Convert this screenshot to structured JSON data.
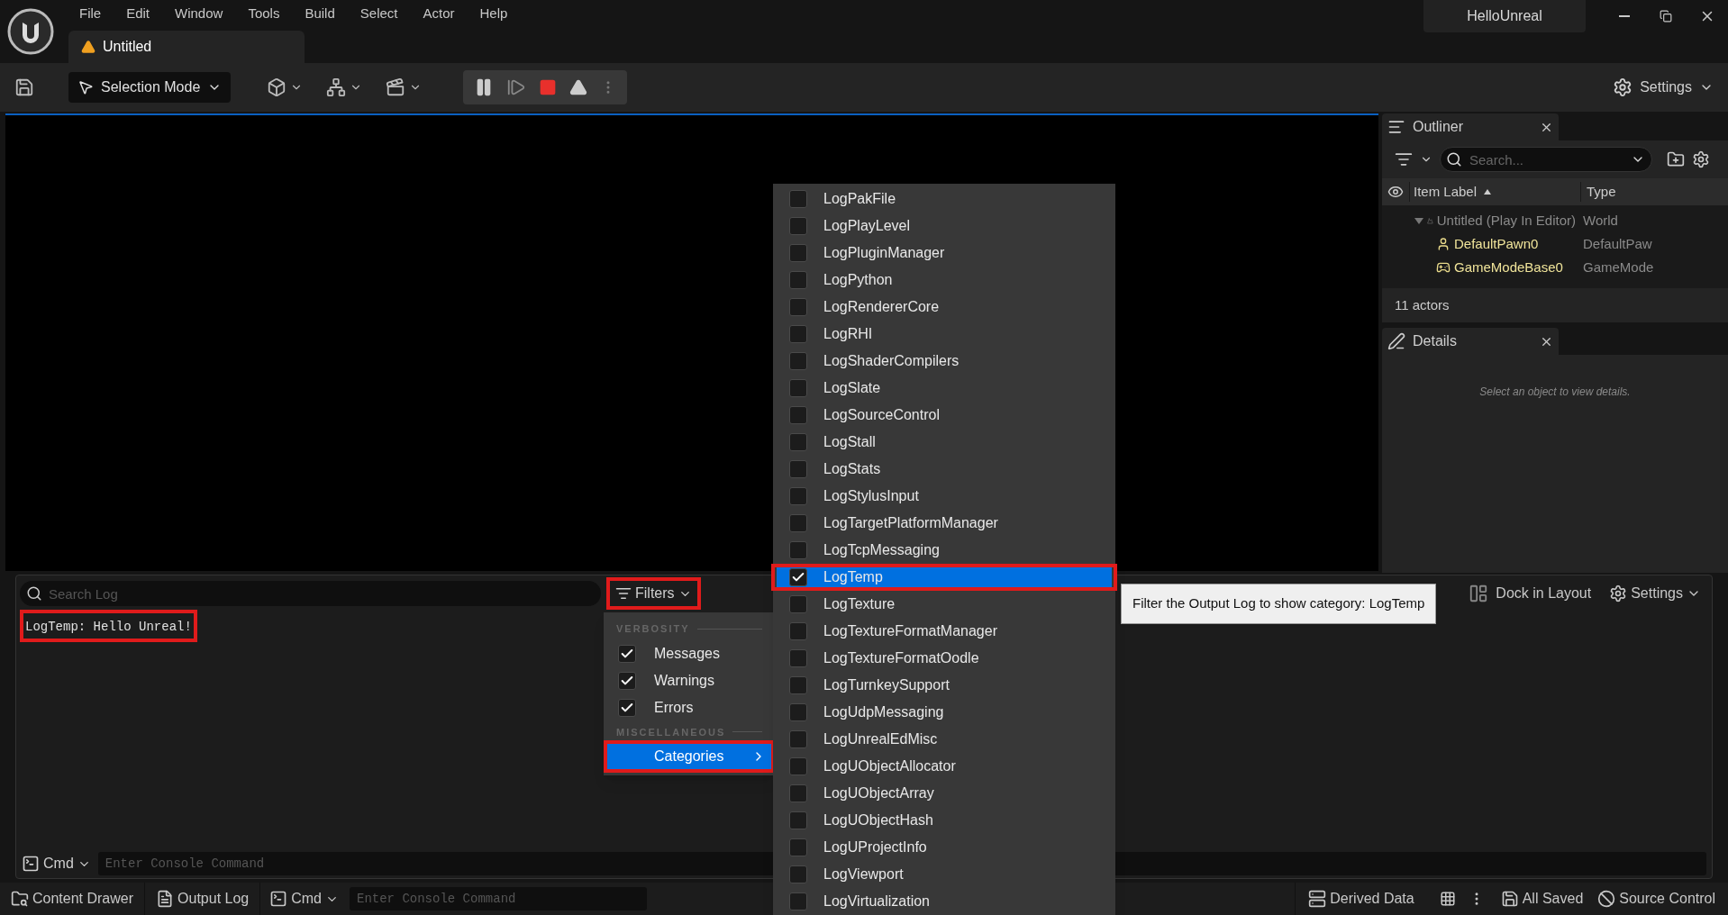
{
  "menu": [
    "File",
    "Edit",
    "Window",
    "Tools",
    "Build",
    "Select",
    "Actor",
    "Help"
  ],
  "project": "HelloUnreal",
  "document_tab": {
    "label": "Untitled"
  },
  "toolbar": {
    "mode": "Selection Mode",
    "settings": "Settings"
  },
  "outliner": {
    "title": "Outliner",
    "search_placeholder": "Search...",
    "columns": [
      "Item Label",
      "Type"
    ],
    "tree": [
      {
        "label": "Untitled (Play In Editor)",
        "type": "World",
        "expanded": true,
        "children": [
          {
            "label": "DefaultPawn0",
            "type": "DefaultPaw"
          },
          {
            "label": "GameModeBase0",
            "type": "GameMode"
          }
        ]
      }
    ],
    "count": "11 actors"
  },
  "details": {
    "title": "Details",
    "empty_text": "Select an object to view details."
  },
  "output_log": {
    "search_placeholder": "Search Log",
    "filters_button": {
      "label": "Filters",
      "highlighted": true
    },
    "lines": [
      {
        "text": "LogTemp: Hello Unreal!",
        "highlighted": true
      }
    ],
    "dock_button": "Dock in Layout",
    "settings_button": "Settings",
    "cmd_label": "Cmd",
    "cmd_placeholder": "Enter Console Command"
  },
  "filters_menu": {
    "sections": [
      {
        "heading": "VERBOSITY",
        "items": [
          {
            "kind": "checkbox",
            "label": "Messages",
            "checked": true,
            "selected": false,
            "highlighted": false
          },
          {
            "kind": "checkbox",
            "label": "Warnings",
            "checked": true,
            "selected": false,
            "highlighted": false
          },
          {
            "kind": "checkbox",
            "label": "Errors",
            "checked": true,
            "selected": false,
            "highlighted": false
          }
        ]
      },
      {
        "heading": "MISCELLANEOUS",
        "items": [
          {
            "kind": "submenu",
            "label": "Categories",
            "selected": true,
            "highlighted": true
          }
        ]
      }
    ]
  },
  "categories_menu": {
    "items": [
      {
        "label": "LogPakFile",
        "checked": false,
        "selected": false,
        "highlighted": false
      },
      {
        "label": "LogPlayLevel",
        "checked": false,
        "selected": false,
        "highlighted": false
      },
      {
        "label": "LogPluginManager",
        "checked": false,
        "selected": false,
        "highlighted": false
      },
      {
        "label": "LogPython",
        "checked": false,
        "selected": false,
        "highlighted": false
      },
      {
        "label": "LogRendererCore",
        "checked": false,
        "selected": false,
        "highlighted": false
      },
      {
        "label": "LogRHI",
        "checked": false,
        "selected": false,
        "highlighted": false
      },
      {
        "label": "LogShaderCompilers",
        "checked": false,
        "selected": false,
        "highlighted": false
      },
      {
        "label": "LogSlate",
        "checked": false,
        "selected": false,
        "highlighted": false
      },
      {
        "label": "LogSourceControl",
        "checked": false,
        "selected": false,
        "highlighted": false
      },
      {
        "label": "LogStall",
        "checked": false,
        "selected": false,
        "highlighted": false
      },
      {
        "label": "LogStats",
        "checked": false,
        "selected": false,
        "highlighted": false
      },
      {
        "label": "LogStylusInput",
        "checked": false,
        "selected": false,
        "highlighted": false
      },
      {
        "label": "LogTargetPlatformManager",
        "checked": false,
        "selected": false,
        "highlighted": false
      },
      {
        "label": "LogTcpMessaging",
        "checked": false,
        "selected": false,
        "highlighted": false
      },
      {
        "label": "LogTemp",
        "checked": true,
        "selected": true,
        "highlighted": true
      },
      {
        "label": "LogTexture",
        "checked": false,
        "selected": false,
        "highlighted": false
      },
      {
        "label": "LogTextureFormatManager",
        "checked": false,
        "selected": false,
        "highlighted": false
      },
      {
        "label": "LogTextureFormatOodle",
        "checked": false,
        "selected": false,
        "highlighted": false
      },
      {
        "label": "LogTurnkeySupport",
        "checked": false,
        "selected": false,
        "highlighted": false
      },
      {
        "label": "LogUdpMessaging",
        "checked": false,
        "selected": false,
        "highlighted": false
      },
      {
        "label": "LogUnrealEdMisc",
        "checked": false,
        "selected": false,
        "highlighted": false
      },
      {
        "label": "LogUObjectAllocator",
        "checked": false,
        "selected": false,
        "highlighted": false
      },
      {
        "label": "LogUObjectArray",
        "checked": false,
        "selected": false,
        "highlighted": false
      },
      {
        "label": "LogUObjectHash",
        "checked": false,
        "selected": false,
        "highlighted": false
      },
      {
        "label": "LogUProjectInfo",
        "checked": false,
        "selected": false,
        "highlighted": false
      },
      {
        "label": "LogViewport",
        "checked": false,
        "selected": false,
        "highlighted": false
      },
      {
        "label": "LogVirtualization",
        "checked": false,
        "selected": false,
        "highlighted": false
      }
    ]
  },
  "tooltip": "Filter the Output Log to show category: LogTemp",
  "status_bar": {
    "left": [
      "Content Drawer",
      "Output Log"
    ],
    "cmd_label": "Cmd",
    "cmd_placeholder": "Enter Console Command",
    "right": [
      "Derived Data",
      "All Saved",
      "Source Control"
    ]
  }
}
